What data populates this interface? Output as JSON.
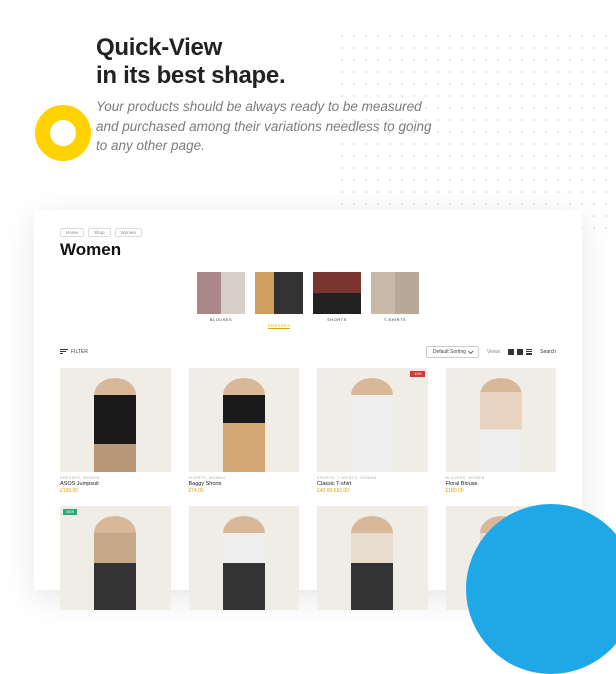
{
  "hero": {
    "title_line1": "Quick-View",
    "title_line2": "in its best shape.",
    "subtitle": "Your products should be always ready to be measured and purchased among their variations needless to going to any other page."
  },
  "breadcrumbs": [
    "Home",
    "Shop",
    "Women"
  ],
  "page_title": "Women",
  "categories": [
    {
      "label": "BLOUSES",
      "active": false
    },
    {
      "label": "DRESSES",
      "active": true
    },
    {
      "label": "SHORTS",
      "active": false
    },
    {
      "label": "T-SHIRTS",
      "active": false
    }
  ],
  "toolbar": {
    "filter_label": "FILTER",
    "sort_label": "Default Sorting",
    "views_label": "Views",
    "search_label": "Search"
  },
  "products": [
    {
      "category": "DRESSES, WOMEN",
      "name": "ASOS Jumpsuit",
      "price": "£195.00",
      "badge": null,
      "img": "m0"
    },
    {
      "category": "SHORTS, WOMEN",
      "name": "Baggy Shorts",
      "price": "£74.00",
      "badge": null,
      "img": "m1"
    },
    {
      "category": "SHORTS, T-SHIRTS, WOMEN",
      "name": "Classic T-shirt",
      "price": "£40.00 £50.00",
      "badge": "hot",
      "badge_text": "-10%",
      "img": "m2"
    },
    {
      "category": "BLOUSES, WOMEN",
      "name": "Floral Blouse",
      "price": "£180.00",
      "badge": null,
      "img": "m3"
    },
    {
      "category": "",
      "name": "",
      "price": "",
      "badge": "new",
      "badge_text": "NEW",
      "img": "m4"
    },
    {
      "category": "",
      "name": "",
      "price": "",
      "badge": null,
      "img": "m5"
    },
    {
      "category": "",
      "name": "",
      "price": "",
      "badge": null,
      "img": "m6"
    },
    {
      "category": "",
      "name": "",
      "price": "",
      "badge": null,
      "img": "m7"
    }
  ]
}
